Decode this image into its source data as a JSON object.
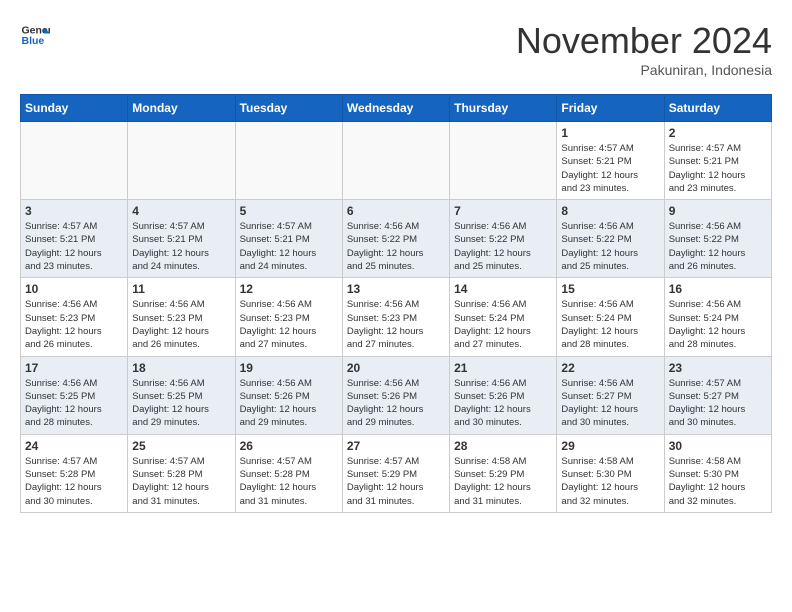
{
  "header": {
    "logo_line1": "General",
    "logo_line2": "Blue",
    "month": "November 2024",
    "location": "Pakuniran, Indonesia"
  },
  "days_of_week": [
    "Sunday",
    "Monday",
    "Tuesday",
    "Wednesday",
    "Thursday",
    "Friday",
    "Saturday"
  ],
  "weeks": [
    [
      {
        "day": "",
        "info": ""
      },
      {
        "day": "",
        "info": ""
      },
      {
        "day": "",
        "info": ""
      },
      {
        "day": "",
        "info": ""
      },
      {
        "day": "",
        "info": ""
      },
      {
        "day": "1",
        "info": "Sunrise: 4:57 AM\nSunset: 5:21 PM\nDaylight: 12 hours\nand 23 minutes."
      },
      {
        "day": "2",
        "info": "Sunrise: 4:57 AM\nSunset: 5:21 PM\nDaylight: 12 hours\nand 23 minutes."
      }
    ],
    [
      {
        "day": "3",
        "info": "Sunrise: 4:57 AM\nSunset: 5:21 PM\nDaylight: 12 hours\nand 23 minutes."
      },
      {
        "day": "4",
        "info": "Sunrise: 4:57 AM\nSunset: 5:21 PM\nDaylight: 12 hours\nand 24 minutes."
      },
      {
        "day": "5",
        "info": "Sunrise: 4:57 AM\nSunset: 5:21 PM\nDaylight: 12 hours\nand 24 minutes."
      },
      {
        "day": "6",
        "info": "Sunrise: 4:56 AM\nSunset: 5:22 PM\nDaylight: 12 hours\nand 25 minutes."
      },
      {
        "day": "7",
        "info": "Sunrise: 4:56 AM\nSunset: 5:22 PM\nDaylight: 12 hours\nand 25 minutes."
      },
      {
        "day": "8",
        "info": "Sunrise: 4:56 AM\nSunset: 5:22 PM\nDaylight: 12 hours\nand 25 minutes."
      },
      {
        "day": "9",
        "info": "Sunrise: 4:56 AM\nSunset: 5:22 PM\nDaylight: 12 hours\nand 26 minutes."
      }
    ],
    [
      {
        "day": "10",
        "info": "Sunrise: 4:56 AM\nSunset: 5:23 PM\nDaylight: 12 hours\nand 26 minutes."
      },
      {
        "day": "11",
        "info": "Sunrise: 4:56 AM\nSunset: 5:23 PM\nDaylight: 12 hours\nand 26 minutes."
      },
      {
        "day": "12",
        "info": "Sunrise: 4:56 AM\nSunset: 5:23 PM\nDaylight: 12 hours\nand 27 minutes."
      },
      {
        "day": "13",
        "info": "Sunrise: 4:56 AM\nSunset: 5:23 PM\nDaylight: 12 hours\nand 27 minutes."
      },
      {
        "day": "14",
        "info": "Sunrise: 4:56 AM\nSunset: 5:24 PM\nDaylight: 12 hours\nand 27 minutes."
      },
      {
        "day": "15",
        "info": "Sunrise: 4:56 AM\nSunset: 5:24 PM\nDaylight: 12 hours\nand 28 minutes."
      },
      {
        "day": "16",
        "info": "Sunrise: 4:56 AM\nSunset: 5:24 PM\nDaylight: 12 hours\nand 28 minutes."
      }
    ],
    [
      {
        "day": "17",
        "info": "Sunrise: 4:56 AM\nSunset: 5:25 PM\nDaylight: 12 hours\nand 28 minutes."
      },
      {
        "day": "18",
        "info": "Sunrise: 4:56 AM\nSunset: 5:25 PM\nDaylight: 12 hours\nand 29 minutes."
      },
      {
        "day": "19",
        "info": "Sunrise: 4:56 AM\nSunset: 5:26 PM\nDaylight: 12 hours\nand 29 minutes."
      },
      {
        "day": "20",
        "info": "Sunrise: 4:56 AM\nSunset: 5:26 PM\nDaylight: 12 hours\nand 29 minutes."
      },
      {
        "day": "21",
        "info": "Sunrise: 4:56 AM\nSunset: 5:26 PM\nDaylight: 12 hours\nand 30 minutes."
      },
      {
        "day": "22",
        "info": "Sunrise: 4:56 AM\nSunset: 5:27 PM\nDaylight: 12 hours\nand 30 minutes."
      },
      {
        "day": "23",
        "info": "Sunrise: 4:57 AM\nSunset: 5:27 PM\nDaylight: 12 hours\nand 30 minutes."
      }
    ],
    [
      {
        "day": "24",
        "info": "Sunrise: 4:57 AM\nSunset: 5:28 PM\nDaylight: 12 hours\nand 30 minutes."
      },
      {
        "day": "25",
        "info": "Sunrise: 4:57 AM\nSunset: 5:28 PM\nDaylight: 12 hours\nand 31 minutes."
      },
      {
        "day": "26",
        "info": "Sunrise: 4:57 AM\nSunset: 5:28 PM\nDaylight: 12 hours\nand 31 minutes."
      },
      {
        "day": "27",
        "info": "Sunrise: 4:57 AM\nSunset: 5:29 PM\nDaylight: 12 hours\nand 31 minutes."
      },
      {
        "day": "28",
        "info": "Sunrise: 4:58 AM\nSunset: 5:29 PM\nDaylight: 12 hours\nand 31 minutes."
      },
      {
        "day": "29",
        "info": "Sunrise: 4:58 AM\nSunset: 5:30 PM\nDaylight: 12 hours\nand 32 minutes."
      },
      {
        "day": "30",
        "info": "Sunrise: 4:58 AM\nSunset: 5:30 PM\nDaylight: 12 hours\nand 32 minutes."
      }
    ]
  ]
}
